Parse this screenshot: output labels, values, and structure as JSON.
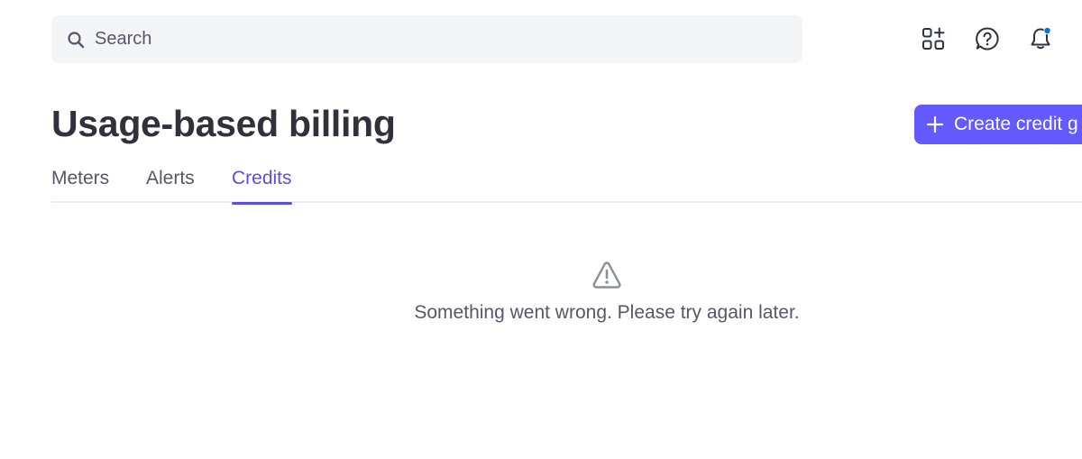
{
  "search": {
    "placeholder": "Search",
    "icon": "search-icon"
  },
  "topbar": {
    "icons": [
      "apps-icon",
      "help-icon",
      "bell-icon"
    ],
    "notification_dot_color": "#0073e6"
  },
  "header": {
    "title": "Usage-based billing",
    "create_button_label": "Create credit g"
  },
  "tabs": [
    {
      "label": "Meters",
      "active": false
    },
    {
      "label": "Alerts",
      "active": false
    },
    {
      "label": "Credits",
      "active": true
    }
  ],
  "error_state": {
    "icon": "warning-icon",
    "message": "Something went wrong. Please try again later."
  },
  "colors": {
    "accent": "#635bff",
    "active_tab": "#5b4fd8",
    "text_primary": "#30313d",
    "text_secondary": "#55576a"
  }
}
